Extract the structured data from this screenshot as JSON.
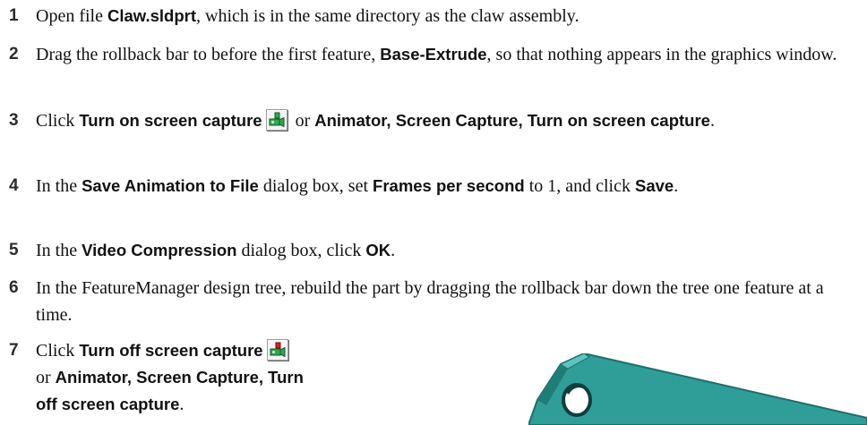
{
  "steps": [
    {
      "num": "1",
      "t1": "Open file ",
      "b1": "Claw.sldprt",
      "t2": ", which is in the same directory as the claw assembly."
    },
    {
      "num": "2",
      "t1": "Drag the rollback bar to before the first feature, ",
      "b1": "Base-Extrude",
      "t2": ", so that nothing appears in the graphics window."
    },
    {
      "num": "3",
      "t1": "Click ",
      "b1": "Turn on screen capture",
      "icon": "screen-capture-on-icon",
      "t2": " or ",
      "b2": "Animator, Screen Capture, Turn on screen capture",
      "t3": "."
    },
    {
      "num": "4",
      "t1": "In the ",
      "b1": "Save Animation to File",
      "t2": " dialog box, set ",
      "b2": "Frames per second",
      "t3": " to 1, and click ",
      "b3": "Save",
      "t4": "."
    },
    {
      "num": "5",
      "t1": "In the ",
      "b1": "Video Compression",
      "t2": " dialog box, click ",
      "b2": "OK",
      "t3": "."
    },
    {
      "num": "6",
      "t1": "In the FeatureManager design tree, rebuild the part by dragging the rollback bar down the tree one feature at a time."
    },
    {
      "num": "7",
      "t1": "Click ",
      "b1": "Turn off screen capture",
      "icon": "screen-capture-off-icon",
      "t2": " or ",
      "b2": "Animator, Screen Capture, Turn off screen capture",
      "t3": "."
    }
  ],
  "colors": {
    "claw_face": "#2f9e98",
    "claw_edge": "#1d6f6b",
    "claw_dark": "#0e3f3c",
    "icon_green": "#2fa84f",
    "icon_red": "#d62020"
  }
}
